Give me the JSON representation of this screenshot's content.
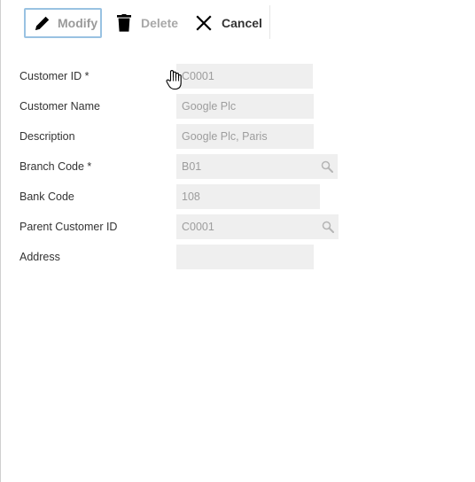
{
  "toolbar": {
    "modify_label": "Modify",
    "delete_label": "Delete",
    "cancel_label": "Cancel"
  },
  "form": {
    "fields": [
      {
        "label": "Customer ID *",
        "value": "C0001",
        "icon": null
      },
      {
        "label": "Customer Name",
        "value": "Google Plc",
        "icon": null
      },
      {
        "label": "Description",
        "value": "Google Plc, Paris",
        "icon": null
      },
      {
        "label": "Branch Code *",
        "value": "B01",
        "icon": "search-icon"
      },
      {
        "label": "Bank Code",
        "value": "108",
        "icon": null
      },
      {
        "label": "Parent Customer ID",
        "value": "C0001",
        "icon": "search-icon"
      },
      {
        "label": "Address",
        "value": "",
        "icon": null
      }
    ]
  },
  "colors": {
    "field_bg": "#efefef",
    "field_text": "#9d9d9d",
    "focus_border": "#99c2e2",
    "label_text": "#333333"
  },
  "icons": {
    "modify": "pencil-icon",
    "delete": "trash-icon",
    "cancel": "close-icon",
    "lookup": "search-icon",
    "pointer": "hand-cursor-icon"
  }
}
